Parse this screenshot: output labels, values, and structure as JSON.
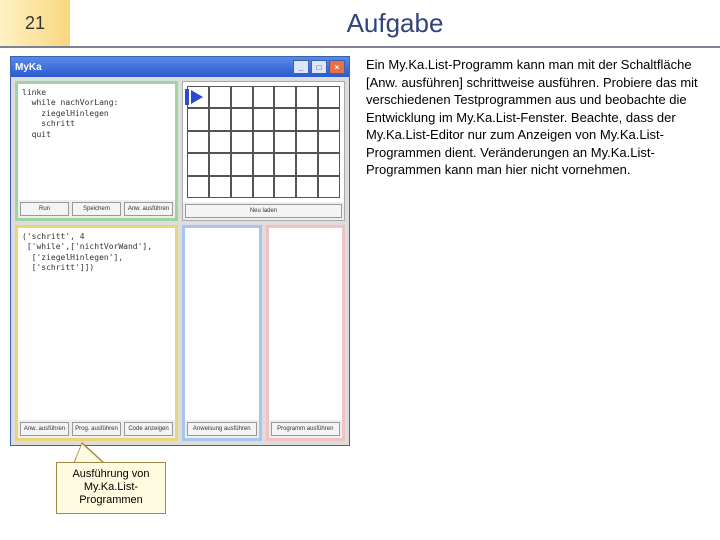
{
  "header": {
    "page_number": "21",
    "title": "Aufgabe"
  },
  "app": {
    "title": "MyKa",
    "controls": {
      "min": "_",
      "max": "□",
      "close": "×"
    },
    "panes": {
      "topleft": {
        "code": "linke\n  while nachVorLang:\n    ziegelHinlegen\n    schritt\n  quit",
        "buttons": [
          "Run",
          "Speichern",
          "Anw. ausführen"
        ]
      },
      "topright": {
        "buttons": [
          "Neu laden"
        ]
      },
      "bottomleft": {
        "code": "('schritt', 4\n ['while',['nichtVorWand'],\n  ['ziegelHinlegen'],\n  ['schritt']])",
        "buttons": [
          "Anw. ausführen",
          "Prog. ausführen",
          "Code anzeigen"
        ]
      },
      "bottomright": {
        "buttons": [
          "Anweisung ausführen",
          "Programm ausführen"
        ]
      }
    }
  },
  "description": "Ein My.Ka.List-Programm kann man mit der Schaltfläche [Anw. ausführen] schrittweise ausführen. Probiere das mit verschiedenen Testprogrammen aus und beobachte die Entwicklung im My.Ka.List-Fenster. Beachte, dass der My.Ka.List-Editor nur zum Anzeigen von My.Ka.List-Programmen dient. Veränderungen an My.Ka.List-Programmen kann man hier nicht vornehmen.",
  "callout": "Ausführung\nvon My.Ka.List-\nProgrammen"
}
